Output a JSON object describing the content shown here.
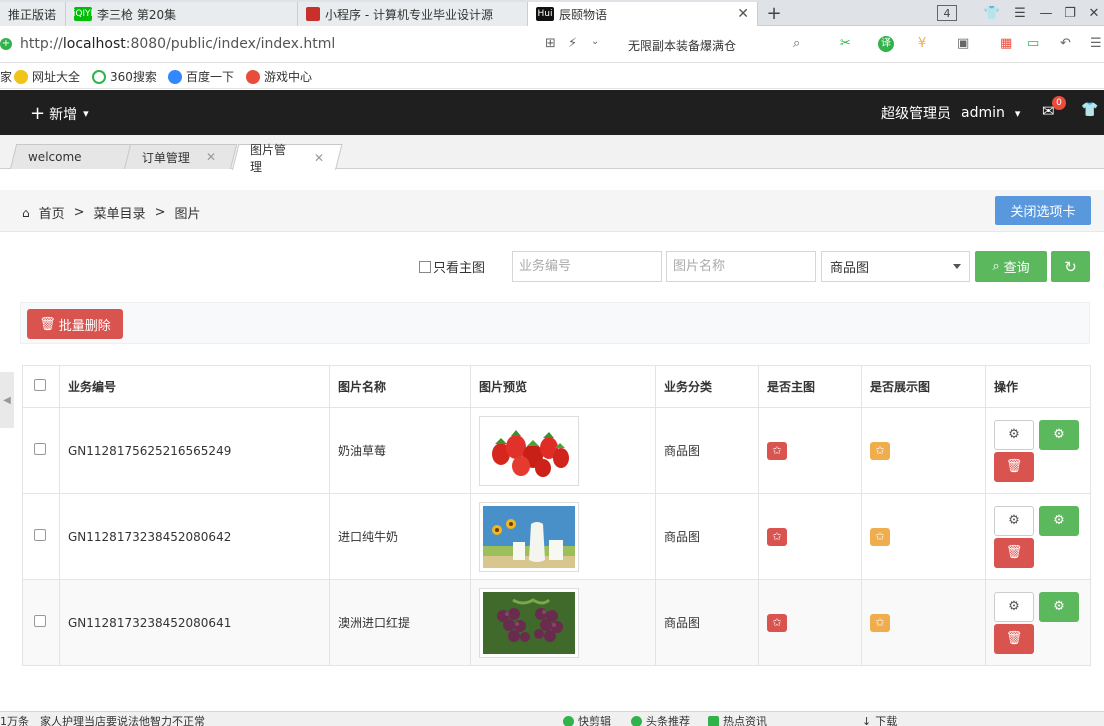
{
  "browser": {
    "tabs": [
      {
        "title": "推正版诺",
        "favicon": "",
        "favicon_color": "#d0d0d0"
      },
      {
        "title": "李三枪 第20集",
        "favicon": "iQIYI",
        "favicon_color": "#00be06"
      },
      {
        "title": "小程序 - 计算机专业毕业设计源",
        "favicon": "",
        "favicon_color": "#c9302c"
      },
      {
        "title": "辰颐物语",
        "favicon": "Hui",
        "favicon_color": "#111111"
      }
    ],
    "tab_count": "4",
    "url_prefix": "http://",
    "url_host": "localhost",
    "url_rest": ":8080/public/index/index.html",
    "promo": "无限副本装备爆满仓",
    "bookmarks": [
      "网址大全",
      "360搜索",
      "百度一下",
      "游戏中心"
    ],
    "bookmark_first": "家"
  },
  "nav": {
    "add_label": "新增",
    "role": "超级管理员",
    "user": "admin",
    "mail_count": "0"
  },
  "pagetabs": [
    {
      "label": "welcome"
    },
    {
      "label": "订单管理"
    },
    {
      "label": "图片管理"
    }
  ],
  "breadcrumb": {
    "home": "首页",
    "sep": ">",
    "level1": "菜单目录",
    "level2": "图片"
  },
  "close_tabs_label": "关闭选项卡",
  "filter": {
    "only_main_label": "只看主图",
    "biz_no_placeholder": "业务编号",
    "pic_name_placeholder": "图片名称",
    "category_selected": "商品图",
    "search_label": "查询"
  },
  "bulk_delete_label": "批量删除",
  "table": {
    "headers": {
      "biz_no": "业务编号",
      "pic_name": "图片名称",
      "preview": "图片预览",
      "category": "业务分类",
      "is_main": "是否主图",
      "is_display": "是否展示图",
      "actions": "操作"
    },
    "rows": [
      {
        "biz_no": "GN1128175625216565249",
        "pic_name": "奶油草莓",
        "category": "商品图"
      },
      {
        "biz_no": "GN1128173238452080642",
        "pic_name": "进口纯牛奶",
        "category": "商品图"
      },
      {
        "biz_no": "GN1128173238452080641",
        "pic_name": "澳洲进口红提",
        "category": "商品图"
      }
    ]
  },
  "statusbar": {
    "left_count": "1万条",
    "left_text": "家人护理当店要说法他智力不正常",
    "item1": "快剪辑",
    "item2": "头条推荐",
    "item3": "热点资讯",
    "item4": "下载"
  },
  "colors": {
    "nav_bg": "#1f1f1f",
    "primary_blue": "#5a98de",
    "success_green": "#5cb85c",
    "danger_red": "#d9534f",
    "warning_orange": "#f0ad4e"
  }
}
